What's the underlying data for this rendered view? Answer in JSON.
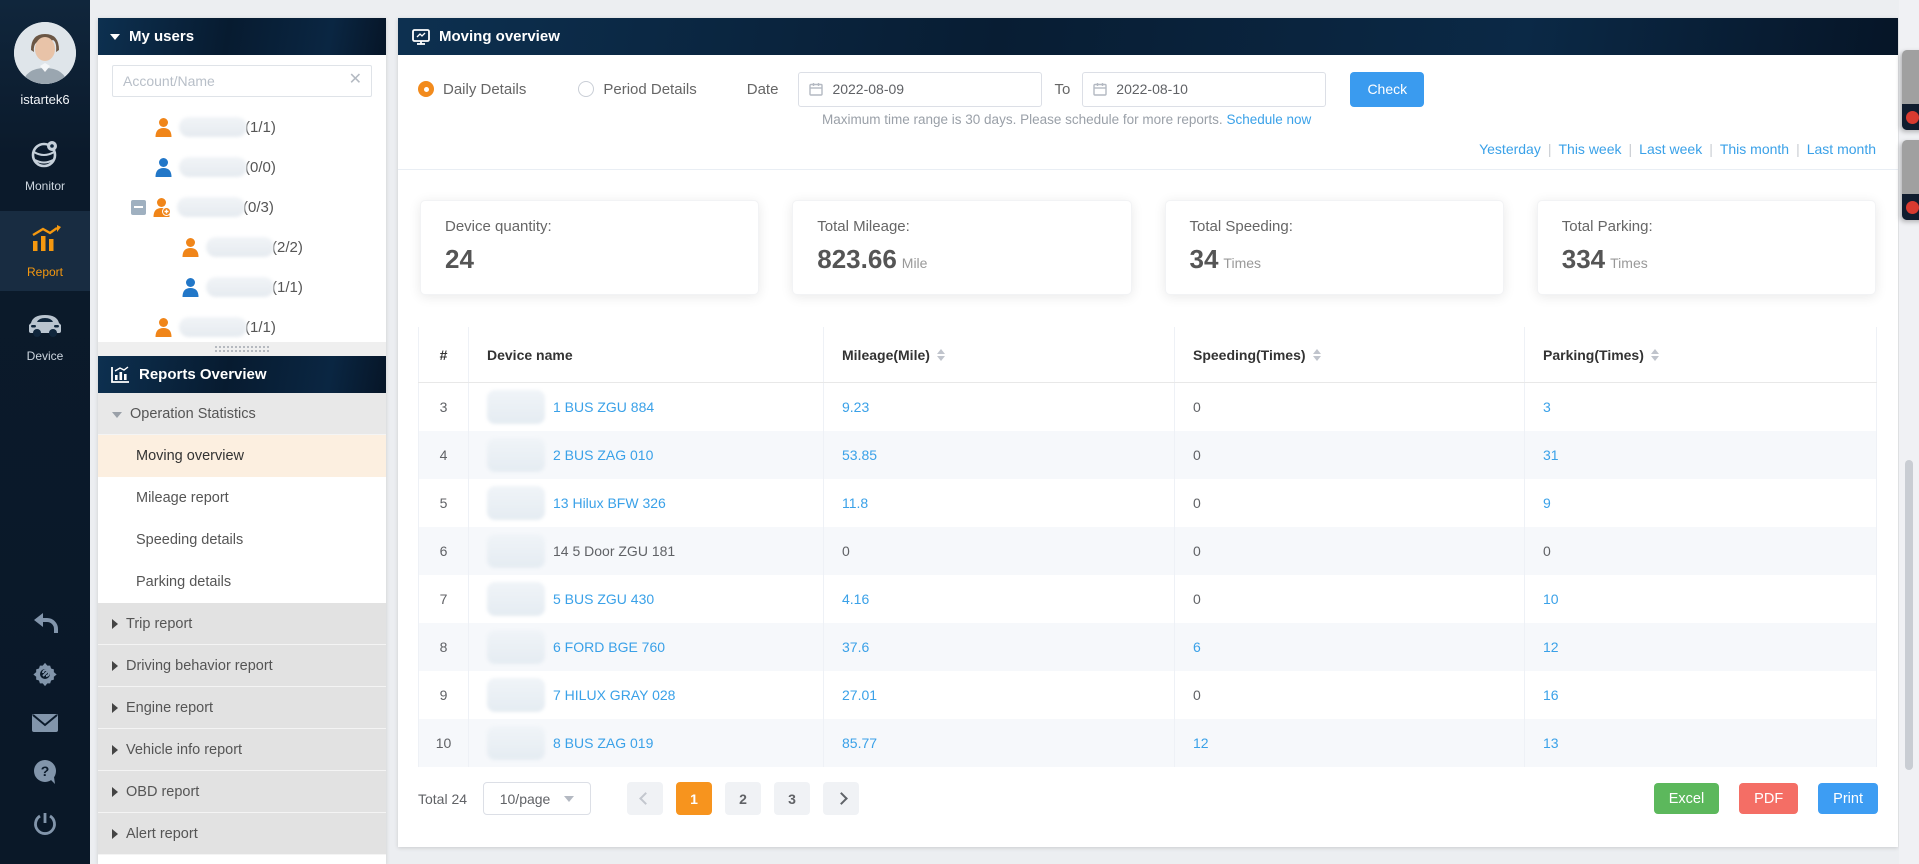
{
  "rail": {
    "username": "istartek6",
    "monitor_label": "Monitor",
    "report_label": "Report",
    "device_label": "Device",
    "accent_orange": "#f5980f"
  },
  "sidebar": {
    "users_panel": {
      "title": "My users",
      "search_placeholder": "Account/Name",
      "tree": [
        {
          "indent": 2,
          "color": "orange",
          "count": "(1/1)",
          "expander": false,
          "add_badge": false
        },
        {
          "indent": 2,
          "color": "blue",
          "count": "(0/0)",
          "expander": false,
          "add_badge": false
        },
        {
          "indent": 1,
          "color": "orange",
          "count": "(0/3)",
          "expander": true,
          "add_badge": true
        },
        {
          "indent": 3,
          "color": "orange",
          "count": "(2/2)",
          "expander": false,
          "add_badge": false
        },
        {
          "indent": 3,
          "color": "blue",
          "count": "(1/1)",
          "expander": false,
          "add_badge": false
        },
        {
          "indent": 2,
          "color": "orange",
          "count": "(1/1)",
          "expander": false,
          "add_badge": false
        }
      ]
    },
    "reports_panel": {
      "title": "Reports Overview",
      "menu": [
        {
          "label": "Operation Statistics",
          "type": "group-open",
          "active": false
        },
        {
          "label": "Moving overview",
          "type": "item",
          "active": true
        },
        {
          "label": "Mileage report",
          "type": "item",
          "active": false
        },
        {
          "label": "Speeding details",
          "type": "item",
          "active": false
        },
        {
          "label": "Parking details",
          "type": "item",
          "active": false
        },
        {
          "label": "Trip report",
          "type": "group",
          "active": false
        },
        {
          "label": "Driving behavior report",
          "type": "group",
          "active": false
        },
        {
          "label": "Engine report",
          "type": "group",
          "active": false
        },
        {
          "label": "Vehicle info report",
          "type": "group",
          "active": false
        },
        {
          "label": "OBD report",
          "type": "group",
          "active": false
        },
        {
          "label": "Alert report",
          "type": "group",
          "active": false
        }
      ]
    }
  },
  "main": {
    "title": "Moving overview",
    "filters": {
      "radio_daily": "Daily Details",
      "radio_period": "Period Details",
      "selected_mode": "Daily Details",
      "date_label": "Date",
      "date_from": "2022-08-09",
      "to_label": "To",
      "date_to": "2022-08-10",
      "check_label": "Check",
      "hint": "Maximum time range is 30 days. Please schedule for more reports.",
      "hint_link": "Schedule now",
      "quick_links": [
        "Yesterday",
        "This week",
        "Last week",
        "This month",
        "Last month"
      ]
    },
    "cards": [
      {
        "label": "Device quantity:",
        "value": "24",
        "unit": ""
      },
      {
        "label": "Total Mileage:",
        "value": "823.66",
        "unit": "Mile"
      },
      {
        "label": "Total Speeding:",
        "value": "34",
        "unit": "Times"
      },
      {
        "label": "Total Parking:",
        "value": "334",
        "unit": "Times"
      }
    ],
    "table": {
      "columns": [
        "#",
        "Device name",
        "Mileage(Mile)",
        "Speeding(Times)",
        "Parking(Times)"
      ],
      "rows": [
        {
          "no": "3",
          "device": "1 BUS ZGU 884",
          "device_link": true,
          "mileage": "9.23",
          "speeding": "0",
          "parking": "3"
        },
        {
          "no": "4",
          "device": "2 BUS ZAG 010",
          "device_link": true,
          "mileage": "53.85",
          "speeding": "0",
          "parking": "31"
        },
        {
          "no": "5",
          "device": "13 Hilux BFW 326",
          "device_link": true,
          "mileage": "11.8",
          "speeding": "0",
          "parking": "9"
        },
        {
          "no": "6",
          "device": "14 5 Door ZGU 181",
          "device_link": false,
          "mileage": "0",
          "speeding": "0",
          "parking": "0"
        },
        {
          "no": "7",
          "device": "5 BUS ZGU 430",
          "device_link": true,
          "mileage": "4.16",
          "speeding": "0",
          "parking": "10"
        },
        {
          "no": "8",
          "device": "6 FORD BGE 760",
          "device_link": true,
          "mileage": "37.6",
          "speeding": "6",
          "parking": "12"
        },
        {
          "no": "9",
          "device": "7 HILUX GRAY 028",
          "device_link": true,
          "mileage": "27.01",
          "speeding": "0",
          "parking": "16"
        },
        {
          "no": "10",
          "device": "8 BUS ZAG 019",
          "device_link": true,
          "mileage": "85.77",
          "speeding": "12",
          "parking": "13"
        }
      ]
    },
    "pagination": {
      "total_label": "Total 24",
      "page_size": "10/page",
      "pages": [
        "1",
        "2",
        "3"
      ],
      "active_page": "1"
    },
    "export": {
      "excel": "Excel",
      "pdf": "PDF",
      "print": "Print"
    },
    "colors": {
      "link": "#3aa1e8",
      "page_active": "#f7941e",
      "excel": "#5cb85c",
      "pdf": "#f46e65",
      "print": "#3d9df3"
    }
  }
}
